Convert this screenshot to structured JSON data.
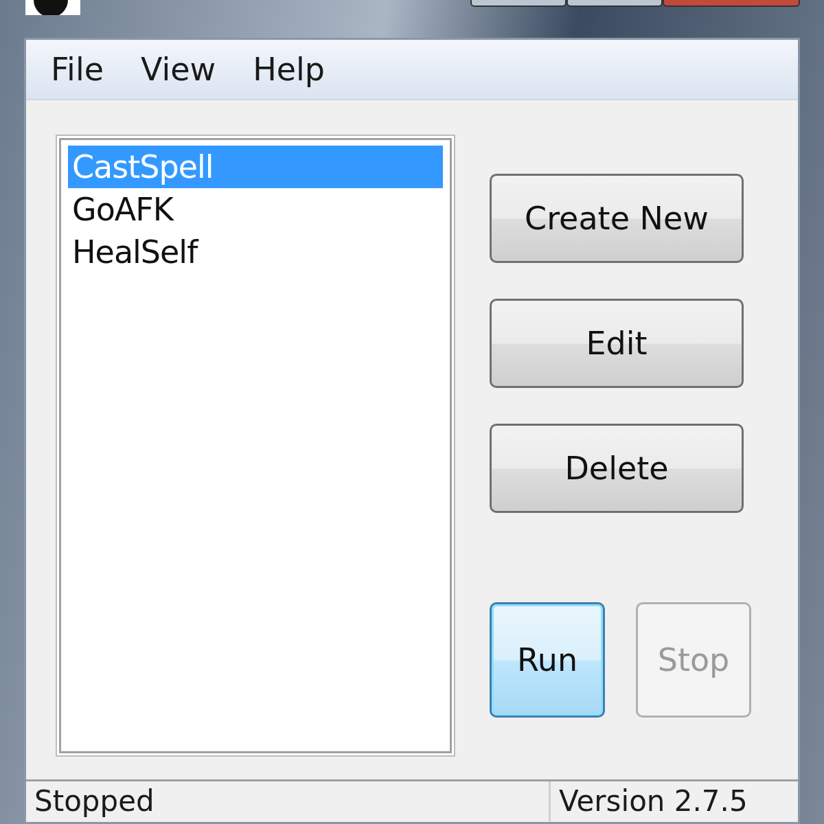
{
  "menu": [
    "File",
    "View",
    "Help"
  ],
  "list_items": [
    {
      "label": "CastSpell",
      "selected": true
    },
    {
      "label": "GoAFK",
      "selected": false
    },
    {
      "label": "HealSelf",
      "selected": false
    }
  ],
  "side_buttons": [
    {
      "label": "Create New",
      "disabled": false
    },
    {
      "label": "Edit",
      "disabled": false
    },
    {
      "label": "Delete",
      "disabled": false
    }
  ],
  "run_buttons": [
    {
      "label": "Run",
      "disabled": false,
      "focused": true
    },
    {
      "label": "Stop",
      "disabled": true,
      "focused": false
    }
  ],
  "status_bar": [
    "Stopped",
    "Version 2.7.5"
  ]
}
